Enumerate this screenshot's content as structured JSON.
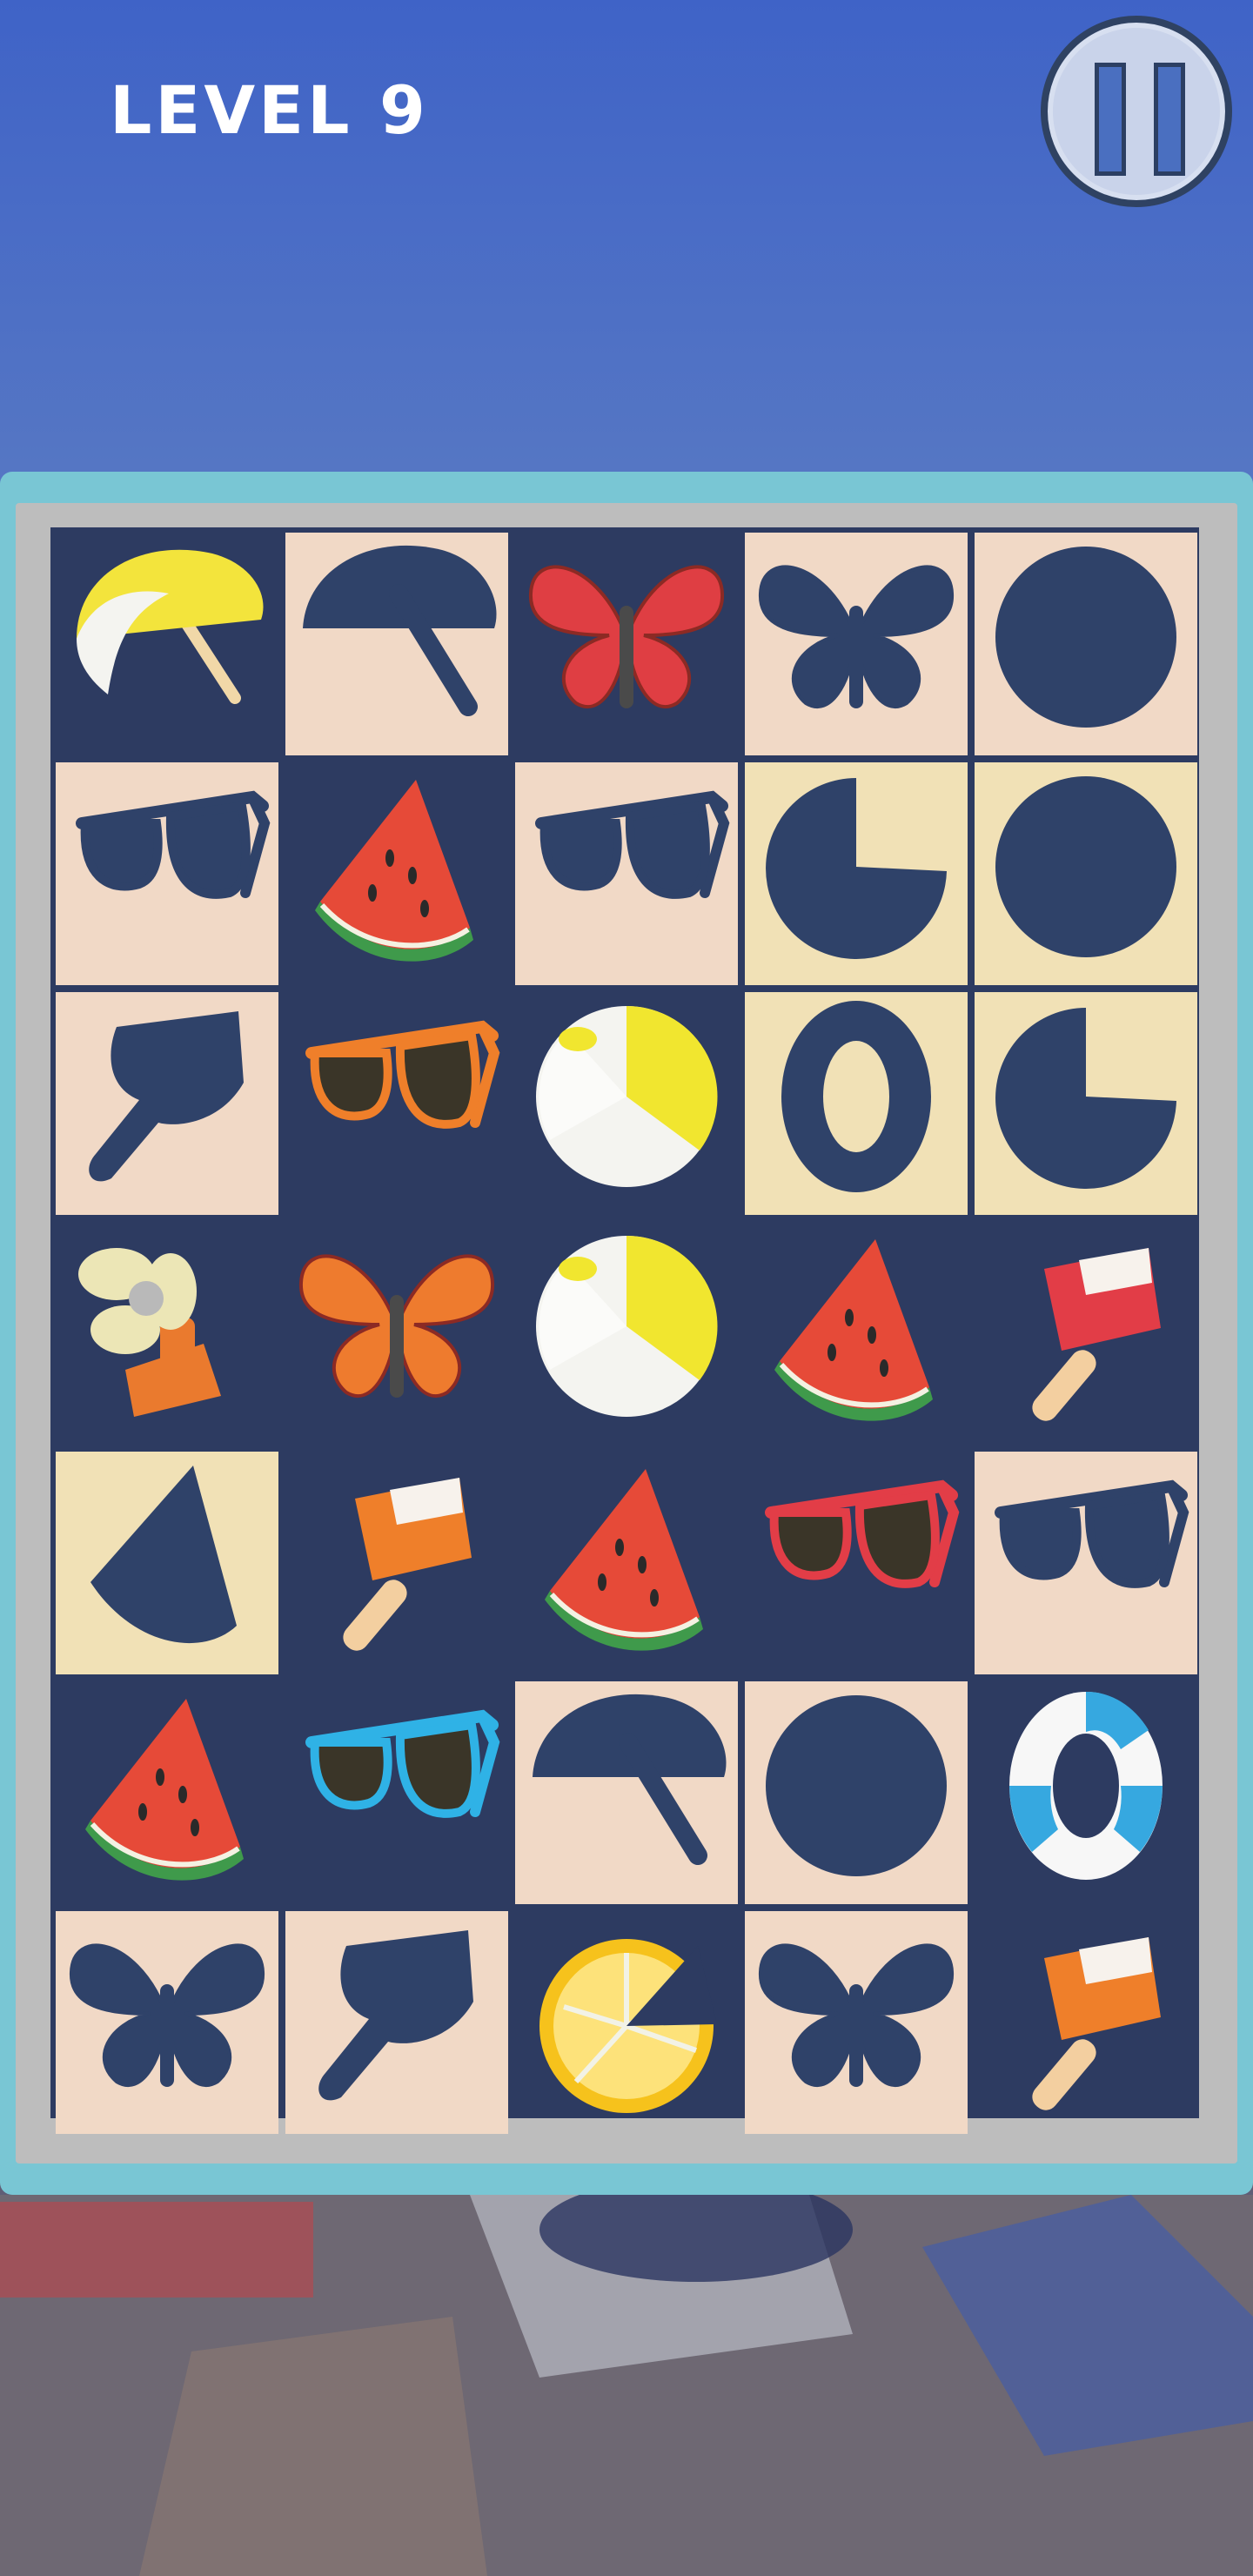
{
  "level_label": "LEVEL 9",
  "pause_button": {
    "icon": "pause-icon"
  },
  "board": {
    "rows": 7,
    "cols": 5,
    "tiles": [
      [
        {
          "state": "item",
          "kind": "umbrella",
          "color": "#f3e43c"
        },
        {
          "state": "shadow",
          "kind": "umbrella"
        },
        {
          "state": "item",
          "kind": "butterfly",
          "color": "#df3e43"
        },
        {
          "state": "shadow",
          "kind": "butterfly"
        },
        {
          "state": "shadow",
          "kind": "ball"
        }
      ],
      [
        {
          "state": "shadow",
          "kind": "sunglasses"
        },
        {
          "state": "item",
          "kind": "watermelon"
        },
        {
          "state": "shadow",
          "kind": "sunglasses"
        },
        {
          "state": "shadow",
          "kind": "lemon",
          "tone": "warm"
        },
        {
          "state": "shadow",
          "kind": "ball",
          "tone": "warm"
        }
      ],
      [
        {
          "state": "shadow",
          "kind": "popsicle"
        },
        {
          "state": "item",
          "kind": "sunglasses",
          "color": "#ef7f2a"
        },
        {
          "state": "item",
          "kind": "ball"
        },
        {
          "state": "shadow",
          "kind": "ring",
          "tone": "warm"
        },
        {
          "state": "shadow",
          "kind": "lemon",
          "tone": "warm"
        }
      ],
      [
        {
          "state": "item",
          "kind": "fan"
        },
        {
          "state": "item",
          "kind": "butterfly",
          "color": "#ee7b2e"
        },
        {
          "state": "item",
          "kind": "ball"
        },
        {
          "state": "item",
          "kind": "watermelon"
        },
        {
          "state": "item",
          "kind": "popsicle",
          "color": "#e23d47"
        }
      ],
      [
        {
          "state": "shadow",
          "kind": "watermelon",
          "tone": "warm"
        },
        {
          "state": "item",
          "kind": "popsicle",
          "color": "#ef7f2a"
        },
        {
          "state": "item",
          "kind": "watermelon"
        },
        {
          "state": "item",
          "kind": "sunglasses",
          "color": "#e23d47"
        },
        {
          "state": "shadow",
          "kind": "sunglasses"
        }
      ],
      [
        {
          "state": "item",
          "kind": "watermelon"
        },
        {
          "state": "item",
          "kind": "sunglasses",
          "color": "#2fb2e6"
        },
        {
          "state": "shadow",
          "kind": "umbrella"
        },
        {
          "state": "shadow",
          "kind": "ball"
        },
        {
          "state": "item",
          "kind": "ring"
        }
      ],
      [
        {
          "state": "shadow",
          "kind": "butterfly"
        },
        {
          "state": "shadow",
          "kind": "popsicle"
        },
        {
          "state": "item",
          "kind": "lemon"
        },
        {
          "state": "shadow",
          "kind": "butterfly"
        },
        {
          "state": "item",
          "kind": "popsicle",
          "color": "#ef7f2a"
        }
      ]
    ]
  }
}
